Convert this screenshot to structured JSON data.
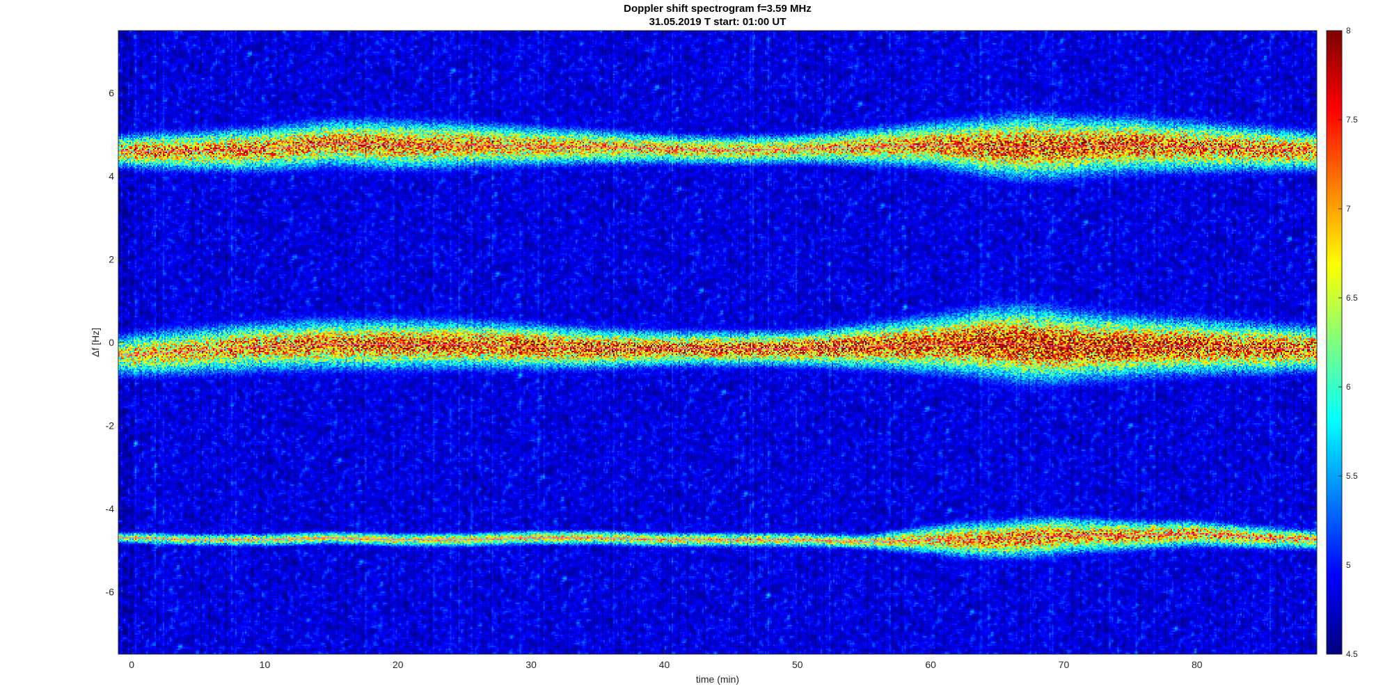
{
  "chart_data": {
    "type": "heatmap",
    "title": "Doppler shift spectrogram f=3.59 MHz",
    "subtitle": "31.05.2019   T start: 01:00 UT",
    "xlabel": "time (min)",
    "ylabel": "Δf [Hz]",
    "xlim": [
      -1,
      89
    ],
    "ylim": [
      -7.5,
      7.5
    ],
    "xticks": [
      0,
      10,
      20,
      30,
      40,
      50,
      60,
      70,
      80
    ],
    "yticks": [
      -6,
      -4,
      -2,
      0,
      2,
      4,
      6
    ],
    "grid": false,
    "colormap": "jet",
    "colorbar": {
      "range": [
        4.5,
        8
      ],
      "ticks": [
        4.5,
        5,
        5.5,
        6,
        6.5,
        7,
        7.5,
        8
      ],
      "placement": "right"
    },
    "bands": [
      {
        "trace": [
          [
            0,
            4.6
          ],
          [
            5,
            4.6
          ],
          [
            10,
            4.65
          ],
          [
            15,
            4.8
          ],
          [
            20,
            4.75
          ],
          [
            25,
            4.75
          ],
          [
            30,
            4.72
          ],
          [
            35,
            4.7
          ],
          [
            40,
            4.65
          ],
          [
            45,
            4.62
          ],
          [
            50,
            4.65
          ],
          [
            55,
            4.7
          ],
          [
            60,
            4.75
          ],
          [
            65,
            4.7
          ],
          [
            70,
            4.7
          ],
          [
            75,
            4.75
          ],
          [
            80,
            4.7
          ],
          [
            85,
            4.65
          ],
          [
            89,
            4.6
          ]
        ],
        "width": [
          [
            0,
            0.35
          ],
          [
            10,
            0.45
          ],
          [
            20,
            0.5
          ],
          [
            30,
            0.4
          ],
          [
            40,
            0.3
          ],
          [
            50,
            0.3
          ],
          [
            60,
            0.45
          ],
          [
            67,
            0.65
          ],
          [
            75,
            0.55
          ],
          [
            89,
            0.4
          ]
        ],
        "intensity": [
          [
            0,
            7.3
          ],
          [
            20,
            7.4
          ],
          [
            40,
            7.1
          ],
          [
            50,
            7.0
          ],
          [
            65,
            7.6
          ],
          [
            80,
            7.5
          ],
          [
            89,
            7.3
          ]
        ]
      },
      {
        "trace": [
          [
            0,
            -0.3
          ],
          [
            5,
            -0.2
          ],
          [
            10,
            -0.1
          ],
          [
            15,
            -0.05
          ],
          [
            20,
            -0.05
          ],
          [
            25,
            -0.05
          ],
          [
            30,
            -0.1
          ],
          [
            35,
            -0.15
          ],
          [
            40,
            -0.15
          ],
          [
            45,
            -0.15
          ],
          [
            50,
            -0.15
          ],
          [
            55,
            -0.1
          ],
          [
            60,
            -0.05
          ],
          [
            65,
            0.0
          ],
          [
            70,
            -0.1
          ],
          [
            75,
            -0.1
          ],
          [
            80,
            -0.1
          ],
          [
            85,
            -0.15
          ],
          [
            89,
            -0.15
          ]
        ],
        "width": [
          [
            0,
            0.45
          ],
          [
            10,
            0.5
          ],
          [
            20,
            0.5
          ],
          [
            30,
            0.45
          ],
          [
            40,
            0.35
          ],
          [
            50,
            0.35
          ],
          [
            60,
            0.55
          ],
          [
            67,
            0.75
          ],
          [
            75,
            0.6
          ],
          [
            89,
            0.45
          ]
        ],
        "intensity": [
          [
            0,
            7.0
          ],
          [
            15,
            7.5
          ],
          [
            30,
            7.6
          ],
          [
            45,
            7.5
          ],
          [
            60,
            7.7
          ],
          [
            67,
            7.9
          ],
          [
            80,
            7.7
          ],
          [
            89,
            7.5
          ]
        ]
      },
      {
        "trace": [
          [
            0,
            -4.7
          ],
          [
            5,
            -4.75
          ],
          [
            10,
            -4.75
          ],
          [
            15,
            -4.7
          ],
          [
            20,
            -4.75
          ],
          [
            25,
            -4.75
          ],
          [
            30,
            -4.7
          ],
          [
            35,
            -4.7
          ],
          [
            40,
            -4.75
          ],
          [
            45,
            -4.75
          ],
          [
            50,
            -4.75
          ],
          [
            55,
            -4.8
          ],
          [
            60,
            -4.75
          ],
          [
            65,
            -4.75
          ],
          [
            70,
            -4.65
          ],
          [
            75,
            -4.65
          ],
          [
            80,
            -4.6
          ],
          [
            85,
            -4.7
          ],
          [
            89,
            -4.75
          ]
        ],
        "width": [
          [
            0,
            0.12
          ],
          [
            30,
            0.15
          ],
          [
            55,
            0.15
          ],
          [
            62,
            0.35
          ],
          [
            68,
            0.4
          ],
          [
            75,
            0.3
          ],
          [
            89,
            0.2
          ]
        ],
        "intensity": [
          [
            0,
            6.7
          ],
          [
            20,
            6.8
          ],
          [
            40,
            6.9
          ],
          [
            55,
            6.8
          ],
          [
            65,
            7.4
          ],
          [
            75,
            7.3
          ],
          [
            89,
            7.0
          ]
        ]
      }
    ]
  }
}
